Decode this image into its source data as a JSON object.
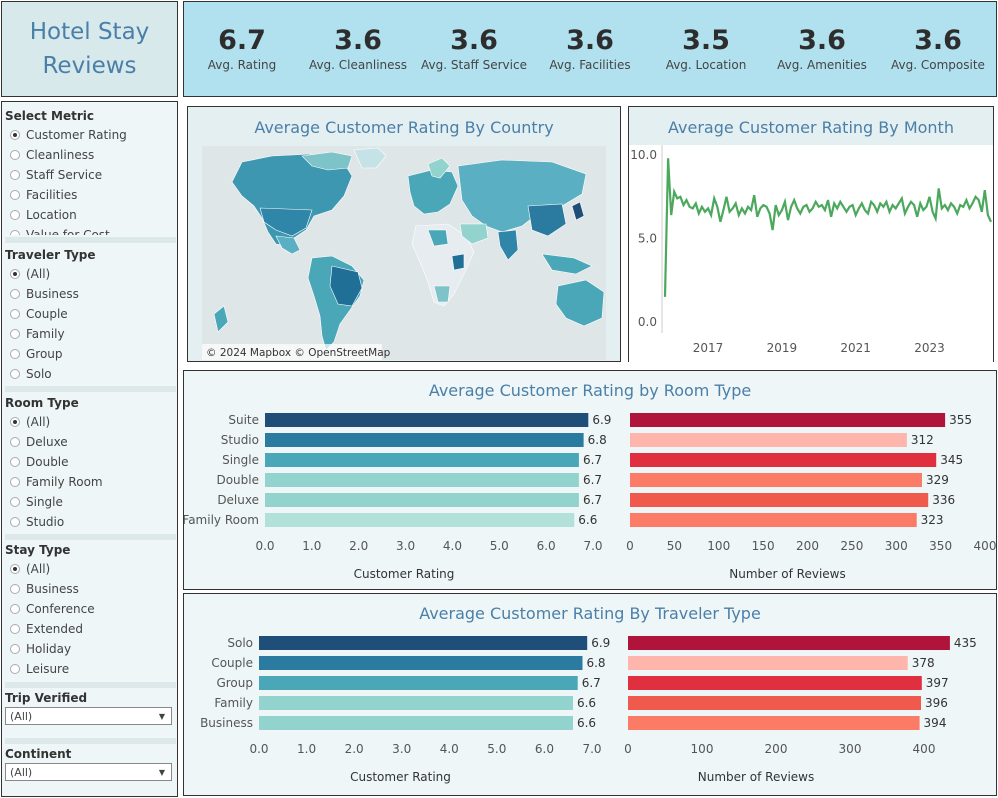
{
  "title": {
    "line1": "Hotel Stay",
    "line2": "Reviews"
  },
  "kpis": [
    {
      "value": "6.7",
      "label": "Avg. Rating"
    },
    {
      "value": "3.6",
      "label": "Avg. Cleanliness"
    },
    {
      "value": "3.6",
      "label": "Avg. Staff Service"
    },
    {
      "value": "3.6",
      "label": "Avg. Facilities"
    },
    {
      "value": "3.5",
      "label": "Avg. Location"
    },
    {
      "value": "3.6",
      "label": "Avg. Amenities"
    },
    {
      "value": "3.6",
      "label": "Avg. Composite"
    }
  ],
  "filters": {
    "metric": {
      "title": "Select Metric",
      "options": [
        "Customer Rating",
        "Cleanliness",
        "Staff Service",
        "Facilities",
        "Location",
        "Value for Cost"
      ]
    },
    "traveler": {
      "title": "Traveler Type",
      "options": [
        "(All)",
        "Business",
        "Couple",
        "Family",
        "Group",
        "Solo"
      ]
    },
    "room": {
      "title": "Room Type",
      "options": [
        "(All)",
        "Deluxe",
        "Double",
        "Family Room",
        "Single",
        "Studio"
      ]
    },
    "stay": {
      "title": "Stay Type",
      "options": [
        "(All)",
        "Business",
        "Conference",
        "Extended",
        "Holiday",
        "Leisure"
      ]
    },
    "verified": {
      "title": "Trip Verified",
      "value": "(All)"
    },
    "continent": {
      "title": "Continent",
      "value": "(All)"
    }
  },
  "colors": {
    "blue_dark": "#1f4e79",
    "blue_mid": "#2b7aa0",
    "teal": "#4aa7b8",
    "teal_light": "#92d3cd",
    "teal_pale": "#b1e1d8",
    "red_dark": "#b0143a",
    "red": "#e0303f",
    "red_mid": "#f05a4d",
    "salmon": "#fb7b66",
    "pink_pale": "#fdb5ac",
    "line_green": "#4ba85c"
  },
  "chart_data": [
    {
      "type": "map",
      "title": "Average Customer Rating By Country",
      "attribution": "© 2024 Mapbox  © OpenStreetMap"
    },
    {
      "type": "line",
      "title": "Average Customer Rating By Month",
      "ylim": [
        0,
        10
      ],
      "yticks": [
        "10.0",
        "5.0",
        "0.0"
      ],
      "xticks": [
        "2017",
        "2019",
        "2021",
        "2023"
      ],
      "x_range": [
        "2015-11",
        "2024-12"
      ],
      "series": [
        {
          "values": [
            1.5,
            9.8,
            6.4,
            7.8,
            7.4,
            7.5,
            7.0,
            7.3,
            6.9,
            6.8,
            7.1,
            6.5,
            6.9,
            6.6,
            6.8,
            6.4,
            7.4,
            6.9,
            6.0,
            6.7,
            7.5,
            6.6,
            6.8,
            7.1,
            6.4,
            6.8,
            6.5,
            6.9,
            6.7,
            7.6,
            6.3,
            6.8,
            7.0,
            6.9,
            6.5,
            5.5,
            7.0,
            6.4,
            6.7,
            7.2,
            6.1,
            6.9,
            7.3,
            6.8,
            6.5,
            6.9,
            7.0,
            6.6,
            6.8,
            7.2,
            6.9,
            7.0,
            6.7,
            7.3,
            6.3,
            7.1,
            6.8,
            7.2,
            6.9,
            6.6,
            6.9,
            7.0,
            6.4,
            6.8,
            7.1,
            6.7,
            6.5,
            7.2,
            7.0,
            6.6,
            7.1,
            6.9,
            7.2,
            6.6,
            7.0,
            6.8,
            7.1,
            7.4,
            6.5,
            6.9,
            7.2,
            7.0,
            6.3,
            7.1,
            6.7,
            6.9,
            7.5,
            6.6,
            6.2,
            8.0,
            6.8,
            7.0,
            6.7,
            7.1,
            6.9,
            6.5,
            7.0,
            6.9,
            7.3,
            6.8,
            7.1,
            7.5,
            7.3,
            6.6,
            7.9,
            6.4,
            6.0
          ]
        }
      ]
    },
    {
      "type": "bar",
      "title": "Average Customer Rating by Room Type",
      "categories": [
        "Suite",
        "Studio",
        "Single",
        "Double",
        "Deluxe",
        "Family Room"
      ],
      "rating": [
        6.9,
        6.8,
        6.7,
        6.7,
        6.7,
        6.6
      ],
      "reviews": [
        355,
        312,
        345,
        329,
        336,
        323
      ],
      "rating_ticks": [
        "0.0",
        "1.0",
        "2.0",
        "3.0",
        "4.0",
        "5.0",
        "6.0",
        "7.0"
      ],
      "reviews_ticks": [
        "0",
        "50",
        "100",
        "150",
        "200",
        "250",
        "300",
        "350",
        "400"
      ],
      "xlabel_left": "Customer Rating",
      "xlabel_right": "Number of Reviews"
    },
    {
      "type": "bar",
      "title": "Average Customer Rating By Traveler Type",
      "categories": [
        "Solo",
        "Couple",
        "Group",
        "Family",
        "Business"
      ],
      "rating": [
        6.9,
        6.8,
        6.7,
        6.6,
        6.6
      ],
      "reviews": [
        435,
        378,
        397,
        396,
        394
      ],
      "rating_ticks": [
        "0.0",
        "1.0",
        "2.0",
        "3.0",
        "4.0",
        "5.0",
        "6.0",
        "7.0"
      ],
      "reviews_ticks": [
        "0",
        "100",
        "200",
        "300",
        "400"
      ],
      "xlabel_left": "Customer Rating",
      "xlabel_right": "Number of Reviews"
    }
  ]
}
